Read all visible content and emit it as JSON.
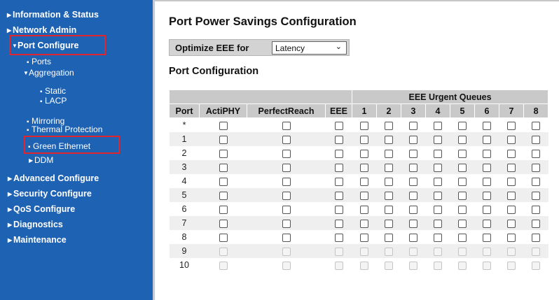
{
  "sidebar": {
    "information_status": "Information & Status",
    "network_admin": "Network Admin",
    "port_configure": "Port Configure",
    "ports": "Ports",
    "aggregation": "Aggregation",
    "static": "Static",
    "lacp": "LACP",
    "mirroring": "Mirroring",
    "thermal_protection": "Thermal Protection",
    "green_ethernet": "Green Ethernet",
    "ddm": "DDM",
    "advanced_configure": "Advanced Configure",
    "security_configure": "Security Configure",
    "qos_configure": "QoS Configure",
    "diagnostics": "Diagnostics",
    "maintenance": "Maintenance"
  },
  "page": {
    "title": "Port Power Savings Configuration",
    "optimize_label": "Optimize EEE for",
    "optimize_value": "Latency",
    "section_title": "Port Configuration"
  },
  "table": {
    "group_header": "EEE Urgent Queues",
    "headers": [
      "Port",
      "ActiPHY",
      "PerfectReach",
      "EEE"
    ],
    "queues": [
      "1",
      "2",
      "3",
      "4",
      "5",
      "6",
      "7",
      "8"
    ],
    "rows": [
      {
        "port": "*",
        "enabled": true
      },
      {
        "port": "1",
        "enabled": true
      },
      {
        "port": "2",
        "enabled": true
      },
      {
        "port": "3",
        "enabled": true
      },
      {
        "port": "4",
        "enabled": true
      },
      {
        "port": "5",
        "enabled": true
      },
      {
        "port": "6",
        "enabled": true
      },
      {
        "port": "7",
        "enabled": true
      },
      {
        "port": "8",
        "enabled": true
      },
      {
        "port": "9",
        "enabled": false
      },
      {
        "port": "10",
        "enabled": false
      }
    ]
  },
  "colors": {
    "sidebar_bg": "#1e62b4",
    "highlight": "#e0262c",
    "header_bg": "#c9c9c9",
    "row_alt": "#efefef"
  }
}
